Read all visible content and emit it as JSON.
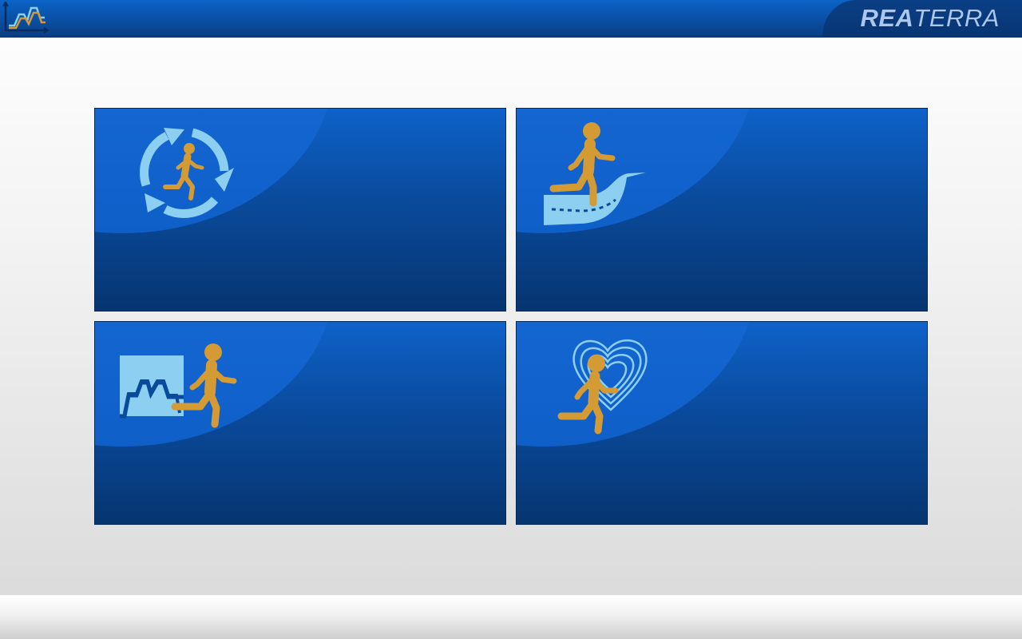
{
  "header": {
    "brand_bold": "REA",
    "brand_light": "TERRA"
  },
  "icons": {
    "app_logo": "chart-line-icon",
    "tile_1": "repeat-cycle-runner-icon",
    "tile_2": "runner-on-track-icon",
    "tile_3": "runner-with-profile-chart-icon",
    "tile_4": "runner-with-heart-icon"
  },
  "colors": {
    "header_blue": "#0a4fa3",
    "tile_blue": "#0a4a9c",
    "runner_gold": "#d49a33",
    "light_blue": "#8ccff0"
  }
}
